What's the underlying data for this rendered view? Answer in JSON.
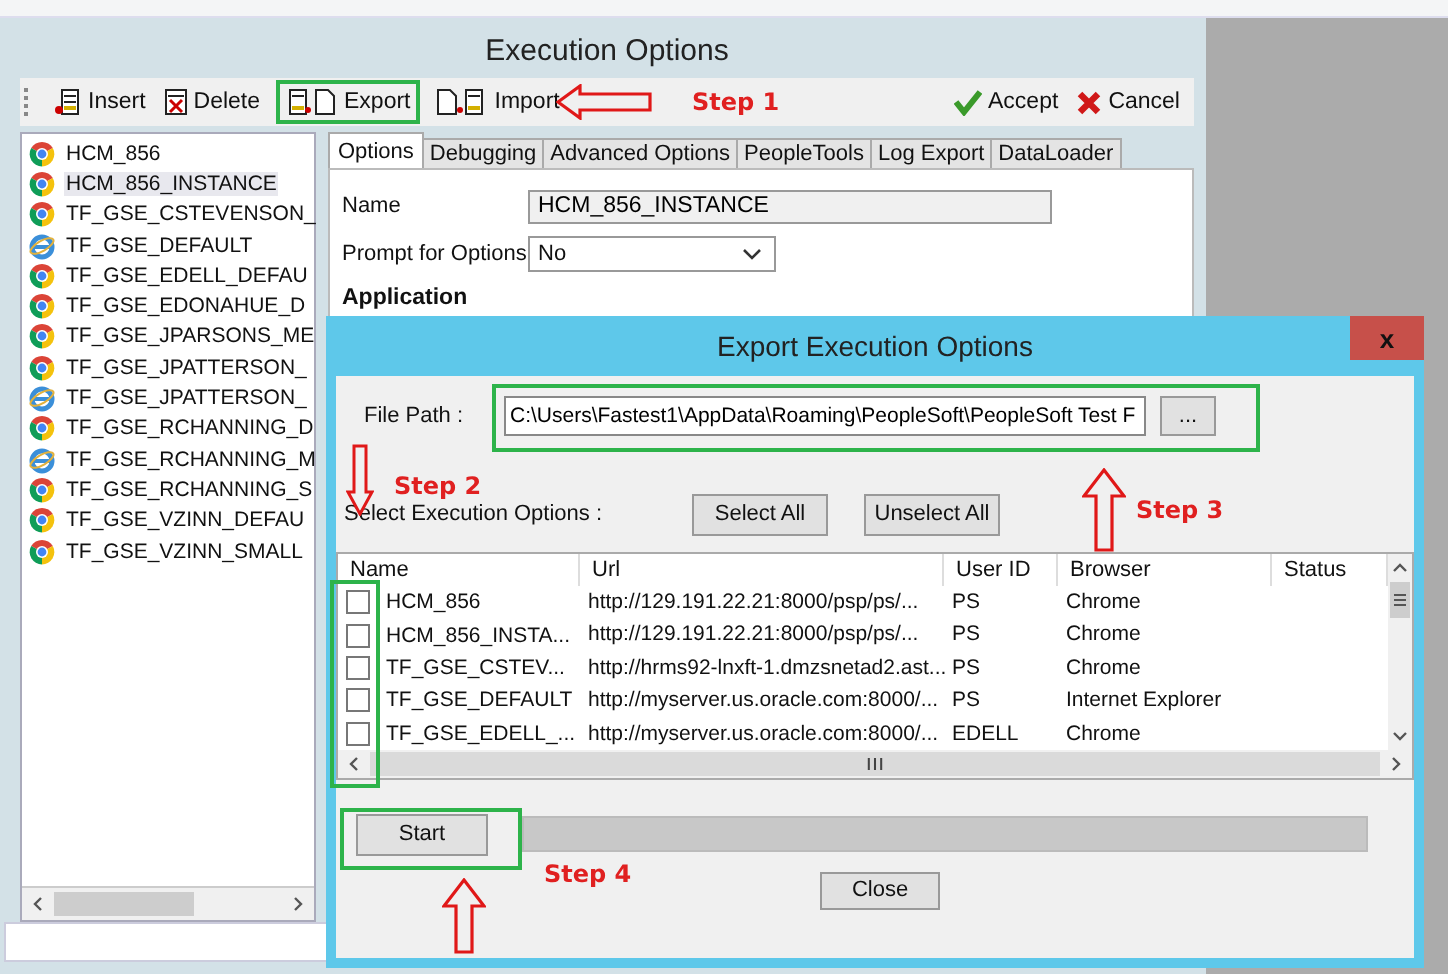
{
  "window": {
    "title": "Execution Options"
  },
  "toolbar": [
    {
      "label": "Insert",
      "kind": "insert",
      "highlighted": false
    },
    {
      "label": "Delete",
      "kind": "delete",
      "highlighted": false
    },
    {
      "label": "Export",
      "kind": "export",
      "highlighted": true
    },
    {
      "label": "Import",
      "kind": "import",
      "highlighted": false
    },
    {
      "label": "Accept",
      "kind": "accept",
      "highlighted": false
    },
    {
      "label": "Cancel",
      "kind": "cancel",
      "highlighted": false
    }
  ],
  "sidebar": {
    "items": [
      {
        "label": "HCM_856",
        "kind": "chrome",
        "selected": false
      },
      {
        "label": "HCM_856_INSTANCE",
        "kind": "chrome",
        "selected": true
      },
      {
        "label": "TF_GSE_CSTEVENSON_",
        "kind": "chrome",
        "selected": false
      },
      {
        "label": "TF_GSE_DEFAULT",
        "kind": "ie",
        "selected": false
      },
      {
        "label": "TF_GSE_EDELL_DEFAU",
        "kind": "chrome",
        "selected": false
      },
      {
        "label": "TF_GSE_EDONAHUE_D",
        "kind": "chrome",
        "selected": false
      },
      {
        "label": "TF_GSE_JPARSONS_ME",
        "kind": "chrome",
        "selected": false
      },
      {
        "label": "TF_GSE_JPATTERSON_",
        "kind": "chrome",
        "selected": false
      },
      {
        "label": "TF_GSE_JPATTERSON_",
        "kind": "ie",
        "selected": false
      },
      {
        "label": "TF_GSE_RCHANNING_D",
        "kind": "chrome",
        "selected": false
      },
      {
        "label": "TF_GSE_RCHANNING_M",
        "kind": "ie",
        "selected": false
      },
      {
        "label": "TF_GSE_RCHANNING_S",
        "kind": "chrome",
        "selected": false
      },
      {
        "label": "TF_GSE_VZINN_DEFAU",
        "kind": "chrome",
        "selected": false
      },
      {
        "label": "TF_GSE_VZINN_SMALL",
        "kind": "chrome",
        "selected": false
      }
    ]
  },
  "tabs": [
    {
      "label": "Options",
      "selected": true
    },
    {
      "label": "Debugging",
      "selected": false
    },
    {
      "label": "Advanced Options",
      "selected": false
    },
    {
      "label": "PeopleTools",
      "selected": false
    },
    {
      "label": "Log Export",
      "selected": false
    },
    {
      "label": "DataLoader",
      "selected": false
    }
  ],
  "form": {
    "name_label": "Name",
    "name_value": "HCM_856_INSTANCE",
    "prompt_label": "Prompt for Options",
    "prompt_value": "No",
    "section": "Application"
  },
  "dialog": {
    "title": "Export Execution Options",
    "close": "x",
    "file_path_label": "File Path :",
    "file_path_value": "C:\\Users\\Fastest1\\AppData\\Roaming\\PeopleSoft\\PeopleSoft Test F",
    "browse_button": "...",
    "select_label": "Select Execution Options :",
    "select_all": "Select All",
    "unselect_all": "Unselect All",
    "columns": [
      "Name",
      "Url",
      "User ID",
      "Browser",
      "Status"
    ],
    "rows": [
      {
        "name": "HCM_856",
        "url": "http://129.191.22.21:8000/psp/ps/...",
        "user_id": "PS",
        "browser": "Chrome",
        "checked": false
      },
      {
        "name": "HCM_856_INSTA...",
        "url": "http://129.191.22.21:8000/psp/ps/...",
        "user_id": "PS",
        "browser": "Chrome",
        "checked": false
      },
      {
        "name": "TF_GSE_CSTEV...",
        "url": "http://hrms92-lnxft-1.dmzsnetad2.ast...",
        "user_id": "PS",
        "browser": "Chrome",
        "checked": false
      },
      {
        "name": "TF_GSE_DEFAULT",
        "url": "http://myserver.us.oracle.com:8000/...",
        "user_id": "PS",
        "browser": "Internet Explorer",
        "checked": false
      },
      {
        "name": "TF_GSE_EDELL_...",
        "url": "http://myserver.us.oracle.com:8000/...",
        "user_id": "EDELL",
        "browser": "Chrome",
        "checked": false
      }
    ],
    "start": "Start",
    "progress": {
      "level": 0
    },
    "close_button": "Close"
  },
  "annotations": [
    "Step 1",
    "Step 2",
    "Step 3",
    "Step 4"
  ]
}
